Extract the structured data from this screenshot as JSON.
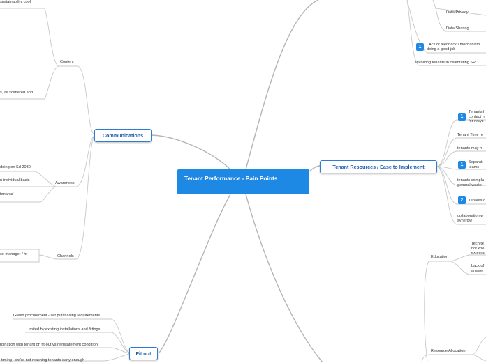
{
  "root": {
    "title": "Tenant Performance - Pain Points"
  },
  "communications": {
    "label": "Communications",
    "content": {
      "label": "Content",
      "items": [
        "sustainability cool",
        "s, all scattered and"
      ]
    },
    "awareness": {
      "label": "Awareness",
      "items": [
        "doing on Sd 2030",
        "n individual basis",
        "tenants'"
      ]
    },
    "channels": {
      "label": "Channels",
      "items": [
        "ce manager / hr"
      ]
    }
  },
  "fitout": {
    "label": "Fit out",
    "items": [
      "Green procurement - set purchasing requirements",
      "Limited by existing installations and fittings",
      "rdination with tenant on fit-out vs reinstatement condition",
      "timing - we're not reaching tenants early enough"
    ]
  },
  "top_right": {
    "data_privacy": "Data Privacy",
    "data_sharing": "Data Sharing",
    "feedback": "LAck of feedback / mechanism doing a good job",
    "feedback_badge": "1",
    "celebrating": "Involving tenants in celebrating SPL"
  },
  "resources": {
    "label": "Tenant Resources / Ease to Implement",
    "items": [
      {
        "text": "Tenants h contact h for recyc",
        "badge": "1"
      },
      {
        "text": "Tenant Time re",
        "badge": ""
      },
      {
        "text": "tenants may h",
        "badge": ""
      },
      {
        "text": "Separati teams -",
        "badge": "1"
      },
      {
        "text": "tenants compla general waste",
        "badge": ""
      },
      {
        "text": "Tenants c",
        "badge": "2"
      },
      {
        "text": "collaboration w synergy!",
        "badge": ""
      }
    ]
  },
  "education": {
    "label": "Education",
    "items": [
      "Tech te not kno externa",
      "Lack of answer"
    ]
  },
  "resource_allocation": {
    "label": "Resource Allocation"
  },
  "colors": {
    "branch": "#b0b0b0",
    "root": "#1e88e5",
    "main_border": "#2e7bd1"
  }
}
